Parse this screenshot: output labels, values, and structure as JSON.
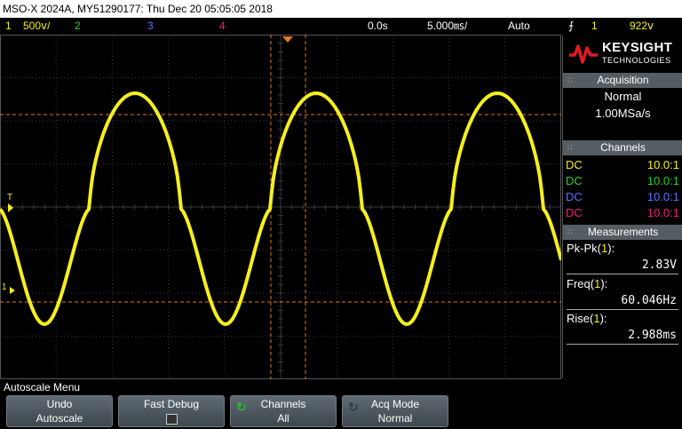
{
  "title": "MSO-X 2024A, MY51290177: Thu Dec 20 05:05:05 2018",
  "status": {
    "ch1_num": "1",
    "ch1_scale": "500ⅴ/",
    "ch2_num": "2",
    "ch3_num": "3",
    "ch4_num": "4",
    "delay": "0.0s",
    "timebase": "5.000㎳/",
    "trigger_mode": "Auto",
    "trigger_slope_icon": "rising-edge-icon",
    "trigger_source": "1",
    "trigger_level": "922ⅴ"
  },
  "brand": {
    "name": "KEYSIGHT",
    "sub": "TECHNOLOGIES"
  },
  "acquisition": {
    "header": "Acquisition",
    "mode": "Normal",
    "rate": "1.00MSa/s"
  },
  "channels": {
    "header": "Channels",
    "rows": [
      {
        "coupling": "DC",
        "probe": "10.0:1",
        "color": "#f5ef1e"
      },
      {
        "coupling": "DC",
        "probe": "10.0:1",
        "color": "#2ad12a"
      },
      {
        "coupling": "DC",
        "probe": "10.0:1",
        "color": "#5a72ff"
      },
      {
        "coupling": "DC",
        "probe": "10.0:1",
        "color": "#e8237c"
      }
    ]
  },
  "measurements": {
    "header": "Measurements",
    "items": [
      {
        "label": "Pk-Pk",
        "ch": "1",
        "value": "2.83V"
      },
      {
        "label": "Freq",
        "ch": "1",
        "value": "60.046Hz"
      },
      {
        "label": "Rise",
        "ch": "1",
        "value": "2.988ms"
      }
    ]
  },
  "markers": {
    "trigger_level": "T",
    "ch1_ground": "1"
  },
  "menu": {
    "title": "Autoscale Menu",
    "softkeys": [
      {
        "line1": "Undo",
        "line2": "Autoscale"
      },
      {
        "line1": "Fast Debug",
        "line2": ""
      },
      {
        "line1": "Channels",
        "line2": "All"
      },
      {
        "line1": "Acq Mode",
        "line2": "Normal"
      }
    ]
  },
  "colors": {
    "ch1": "#f5ef1e",
    "ch2": "#2ad12a",
    "ch3": "#5a72ff",
    "ch4": "#e8237c",
    "cursor": "#e07a1e",
    "grid": "#404040"
  }
}
